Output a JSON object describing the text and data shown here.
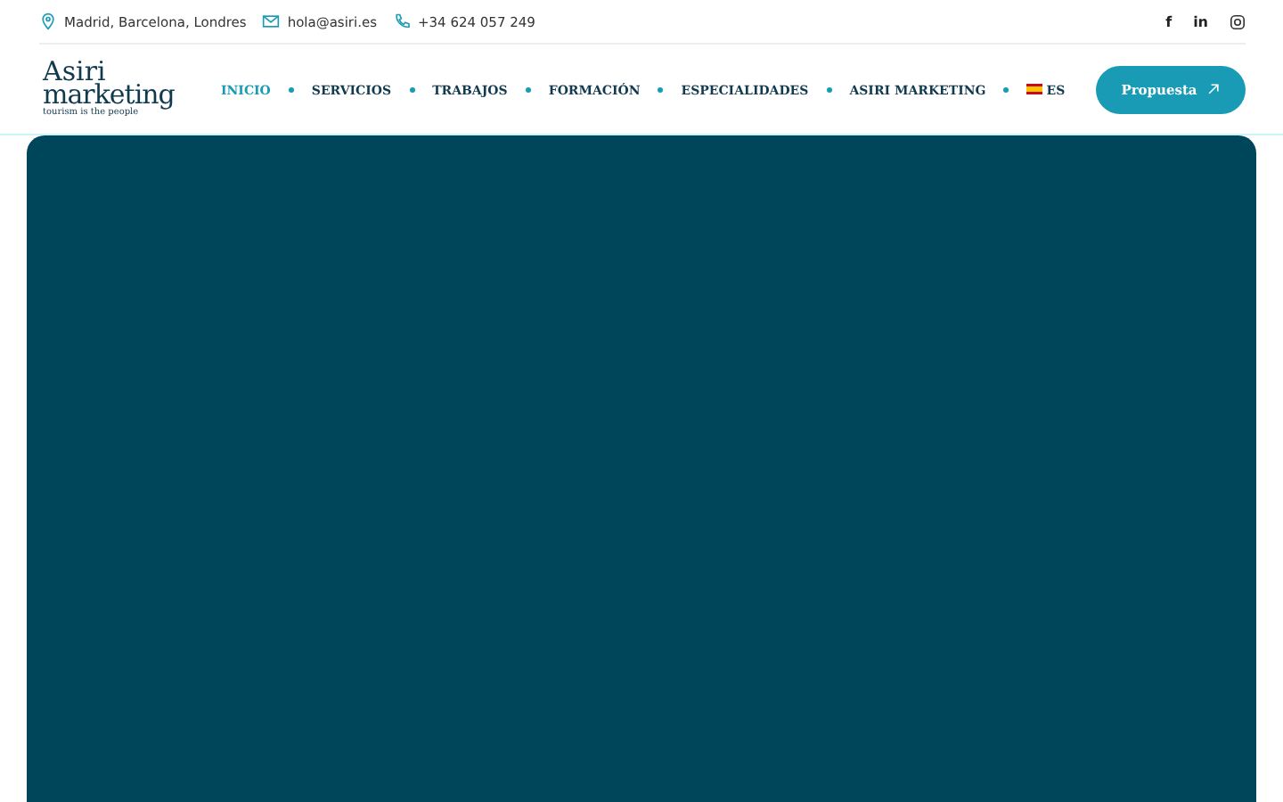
{
  "topbar": {
    "contacts": [
      {
        "kind": "location",
        "text": "Madrid, Barcelona, Londres"
      },
      {
        "kind": "email",
        "text": "hola@asiri.es"
      },
      {
        "kind": "phone",
        "text": "+34 624 057 249"
      }
    ],
    "social": [
      {
        "kind": "text",
        "text": "f"
      },
      {
        "kind": "text",
        "text": "in"
      },
      {
        "kind": "instagram"
      }
    ]
  },
  "logo": {
    "line_1": "Asiri",
    "line_2": "marketing",
    "tagline": "tourism is the people"
  },
  "nav": {
    "items": [
      {
        "label": "INICIO",
        "selected": true
      },
      {
        "label": "SERVICIOS",
        "selected": false
      },
      {
        "label": "TRABAJOS",
        "selected": false
      },
      {
        "label": "FORMACIÓN",
        "selected": false
      },
      {
        "label": "ESPECIALIDADES",
        "selected": false
      },
      {
        "label": "ASIRI MARKETING",
        "selected": false
      }
    ],
    "language": "ES"
  },
  "cta_button": {
    "label": "Propuesta"
  },
  "hero": {
    "kind": "panel"
  }
}
